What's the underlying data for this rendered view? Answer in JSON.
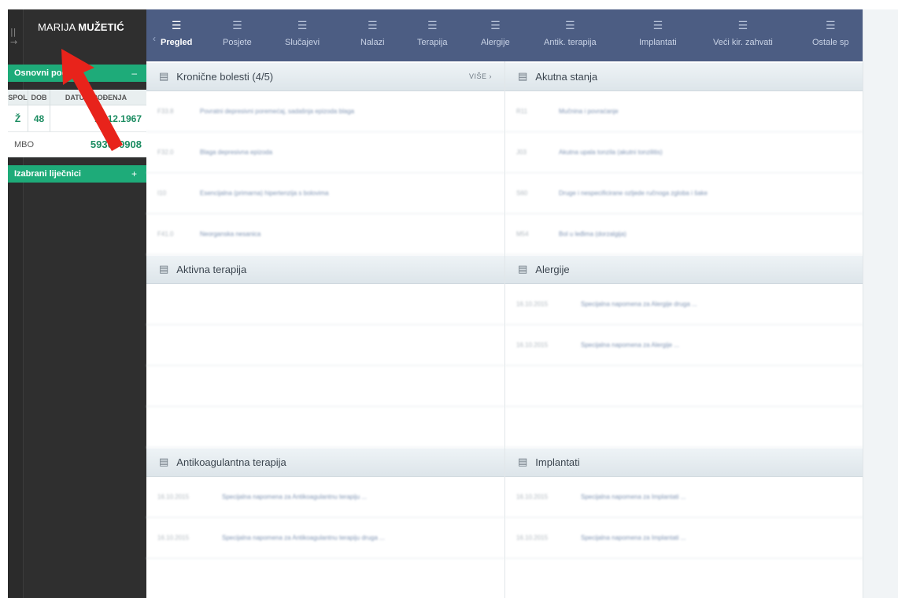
{
  "sidebar": {
    "patient_first": "MARIJA",
    "patient_last": "MUŽETIĆ",
    "basic": {
      "title": "Osnovni podaci",
      "collapse": "–",
      "headers": [
        "SPOL",
        "DOB",
        "DATUM ROĐENJA"
      ],
      "spol": "Ž",
      "dob": "48",
      "datum": "12.12.1967",
      "mbo_label": "MBO",
      "mbo_value": "593060908"
    },
    "doctors": {
      "title": "Izabrani liječnici",
      "add": "+"
    }
  },
  "nav": {
    "tabs": [
      {
        "label": "Pregled"
      },
      {
        "label": "Posjete"
      },
      {
        "label": "Slučajevi"
      },
      {
        "label": "Nalazi"
      },
      {
        "label": "Terapija"
      },
      {
        "label": "Alergije"
      },
      {
        "label": "Antik. terapija"
      },
      {
        "label": "Implantati"
      },
      {
        "label": "Veći kir. zahvati"
      },
      {
        "label": "Ostale sp"
      }
    ]
  },
  "panels": {
    "kronicne": {
      "title": "Kronične bolesti (4/5)",
      "more": "VIŠE  ›",
      "rows": [
        {
          "code": "F33.8",
          "text": "Povratni depresivni poremećaj, sadašnja epizoda blaga"
        },
        {
          "code": "F32.0",
          "text": "Blaga depresivna epizoda"
        },
        {
          "code": "I10",
          "text": "Esencijalna (primarna) hipertenzija s bolovima"
        },
        {
          "code": "F41.0",
          "text": "Neorganska nesanica"
        }
      ]
    },
    "akutna": {
      "title": "Akutna stanja",
      "rows": [
        {
          "code": "R11",
          "text": "Mučnina i povraćanje"
        },
        {
          "code": "J03",
          "text": "Akutna upala tonzila (akutni tonzilitis)"
        },
        {
          "code": "S60",
          "text": "Druge i nespecificirane ozljede ručnoga zgloba i šake"
        },
        {
          "code": "M54",
          "text": "Bol u leđima (dorzalgija)"
        }
      ]
    },
    "aktivna": {
      "title": "Aktivna terapija"
    },
    "alergije": {
      "title": "Alergije",
      "rows": [
        {
          "code": "16.10.2015",
          "text": "Specijalna napomena za Alergije druga ..."
        },
        {
          "code": "16.10.2015",
          "text": "Specijalna napomena za Alergije ..."
        }
      ]
    },
    "antik": {
      "title": "Antikoagulantna terapija",
      "rows": [
        {
          "code": "16.10.2015",
          "text": "Specijalna napomena za Antikoagulantnu terapiju ..."
        },
        {
          "code": "16.10.2015",
          "text": "Specijalna napomena za Antikoagulantnu terapiju druga ..."
        }
      ]
    },
    "implantati": {
      "title": "Implantati",
      "rows": [
        {
          "code": "16.10.2015",
          "text": "Specijalna napomena za Implantati ..."
        },
        {
          "code": "16.10.2015",
          "text": "Specijalna napomena za Implantati ..."
        }
      ]
    }
  },
  "annotation": {
    "color": "#e8231b"
  }
}
